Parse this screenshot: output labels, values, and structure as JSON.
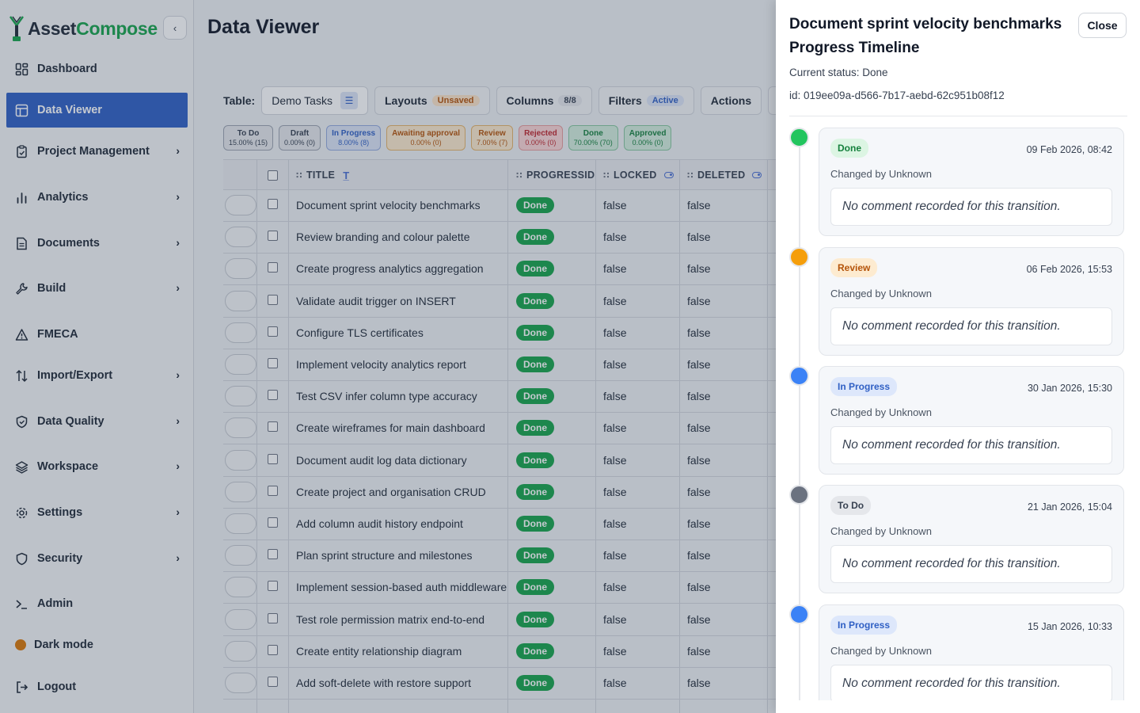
{
  "app": {
    "name_part1": "Asset",
    "name_part2": "Compose",
    "brand_color": "#16a34a"
  },
  "sidebar": {
    "items": [
      {
        "label": "Dashboard",
        "icon": "dashboard-icon",
        "chevron": false,
        "active": false
      },
      {
        "label": "Data Viewer",
        "icon": "table-icon",
        "chevron": false,
        "active": true
      },
      {
        "label": "Project Management",
        "icon": "clipboard-icon",
        "chevron": true,
        "active": false
      },
      {
        "label": "Analytics",
        "icon": "bar-chart-icon",
        "chevron": true,
        "active": false
      },
      {
        "label": "Documents",
        "icon": "document-icon",
        "chevron": true,
        "active": false
      },
      {
        "label": "Build",
        "icon": "wrench-icon",
        "chevron": true,
        "active": false
      },
      {
        "label": "FMECA",
        "icon": "warning-icon",
        "chevron": false,
        "active": false
      },
      {
        "label": "Import/Export",
        "icon": "arrows-up-down-icon",
        "chevron": true,
        "active": false
      },
      {
        "label": "Data Quality",
        "icon": "shield-check-icon",
        "chevron": true,
        "active": false
      },
      {
        "label": "Workspace",
        "icon": "layers-icon",
        "chevron": true,
        "active": false
      },
      {
        "label": "Settings",
        "icon": "gear-icon",
        "chevron": true,
        "active": false
      },
      {
        "label": "Security",
        "icon": "shield-icon",
        "chevron": true,
        "active": false
      },
      {
        "label": "Admin",
        "icon": "terminal-icon",
        "chevron": false,
        "active": false
      }
    ],
    "dark_mode_label": "Dark mode",
    "logout_label": "Logout"
  },
  "page": {
    "title": "Data Viewer"
  },
  "toolbar": {
    "table_label": "Table:",
    "table_value": "Demo Tasks",
    "layouts_label": "Layouts",
    "layouts_badge": "Unsaved",
    "columns_label": "Columns",
    "columns_badge": "8/8",
    "filters_label": "Filters",
    "filters_badge": "Active",
    "actions_label": "Actions"
  },
  "status_chips": [
    {
      "label": "To Do",
      "value": "15.00% (15)",
      "bg": "#e5e7eb",
      "fg": "#374151",
      "border": "#9ca3af"
    },
    {
      "label": "Draft",
      "value": "0.00% (0)",
      "bg": "#e5e7eb",
      "fg": "#374151",
      "border": "#9ca3af"
    },
    {
      "label": "In Progress",
      "value": "8.00% (8)",
      "bg": "#dbe3f5",
      "fg": "#2f5fc4",
      "border": "#93a9dd"
    },
    {
      "label": "Awaiting approval",
      "value": "0.00% (0)",
      "bg": "#fde9cc",
      "fg": "#b45309",
      "border": "#e5b36a"
    },
    {
      "label": "Review",
      "value": "7.00% (7)",
      "bg": "#fde9cc",
      "fg": "#b45309",
      "border": "#e5b36a"
    },
    {
      "label": "Rejected",
      "value": "0.00% (0)",
      "bg": "#fbd5d5",
      "fg": "#c0262d",
      "border": "#e69b9b"
    },
    {
      "label": "Done",
      "value": "70.00% (70)",
      "bg": "#d3eedd",
      "fg": "#15803d",
      "border": "#86c79e"
    },
    {
      "label": "Approved",
      "value": "0.00% (0)",
      "bg": "#d3eedd",
      "fg": "#15803d",
      "border": "#86c79e"
    }
  ],
  "table": {
    "headers": {
      "title": "TITLE",
      "progress": "PROGRESSID",
      "locked": "LOCKED",
      "deleted": "DELETED"
    },
    "rows": [
      {
        "title": "Document sprint velocity benchmarks",
        "status": "Done",
        "locked": "false",
        "deleted": "false"
      },
      {
        "title": "Review branding and colour palette",
        "status": "Done",
        "locked": "false",
        "deleted": "false"
      },
      {
        "title": "Create progress analytics aggregation",
        "status": "Done",
        "locked": "false",
        "deleted": "false"
      },
      {
        "title": "Validate audit trigger on INSERT",
        "status": "Done",
        "locked": "false",
        "deleted": "false"
      },
      {
        "title": "Configure TLS certificates",
        "status": "Done",
        "locked": "false",
        "deleted": "false"
      },
      {
        "title": "Implement velocity analytics report",
        "status": "Done",
        "locked": "false",
        "deleted": "false"
      },
      {
        "title": "Test CSV infer column type accuracy",
        "status": "Done",
        "locked": "false",
        "deleted": "false"
      },
      {
        "title": "Create wireframes for main dashboard",
        "status": "Done",
        "locked": "false",
        "deleted": "false"
      },
      {
        "title": "Document audit log data dictionary",
        "status": "Done",
        "locked": "false",
        "deleted": "false"
      },
      {
        "title": "Create project and organisation CRUD",
        "status": "Done",
        "locked": "false",
        "deleted": "false"
      },
      {
        "title": "Add column audit history endpoint",
        "status": "Done",
        "locked": "false",
        "deleted": "false"
      },
      {
        "title": "Plan sprint structure and milestones",
        "status": "Done",
        "locked": "false",
        "deleted": "false"
      },
      {
        "title": "Implement session-based auth middleware",
        "status": "Done",
        "locked": "false",
        "deleted": "false"
      },
      {
        "title": "Test role permission matrix end-to-end",
        "status": "Done",
        "locked": "false",
        "deleted": "false"
      },
      {
        "title": "Create entity relationship diagram",
        "status": "Done",
        "locked": "false",
        "deleted": "false"
      },
      {
        "title": "Add soft-delete with restore support",
        "status": "Done",
        "locked": "false",
        "deleted": "false"
      }
    ]
  },
  "drawer": {
    "title": "Document sprint velocity benchmarks Progress Timeline",
    "close_label": "Close",
    "current_status": "Current status: Done",
    "id_text": "id: 019ee09a-d566-7b17-aebd-62c951b08f12",
    "timeline": [
      {
        "status": "Done",
        "date": "09 Feb 2026, 08:42",
        "by": "Changed by Unknown",
        "comment": "No comment recorded for this transition.",
        "dot_color": "#22c55e",
        "badge_bg": "#dcf5e3",
        "badge_fg": "#15803d"
      },
      {
        "status": "Review",
        "date": "06 Feb 2026, 15:53",
        "by": "Changed by Unknown",
        "comment": "No comment recorded for this transition.",
        "dot_color": "#f59e0b",
        "badge_bg": "#fdebd0",
        "badge_fg": "#b45309"
      },
      {
        "status": "In Progress",
        "date": "30 Jan 2026, 15:30",
        "by": "Changed by Unknown",
        "comment": "No comment recorded for this transition.",
        "dot_color": "#3b82f6",
        "badge_bg": "#dde7fb",
        "badge_fg": "#2f5fc4"
      },
      {
        "status": "To Do",
        "date": "21 Jan 2026, 15:04",
        "by": "Changed by Unknown",
        "comment": "No comment recorded for this transition.",
        "dot_color": "#6b7280",
        "badge_bg": "#e5e7eb",
        "badge_fg": "#374151"
      },
      {
        "status": "In Progress",
        "date": "15 Jan 2026, 10:33",
        "by": "Changed by Unknown",
        "comment": "No comment recorded for this transition.",
        "dot_color": "#3b82f6",
        "badge_bg": "#dde7fb",
        "badge_fg": "#2f5fc4"
      }
    ]
  }
}
